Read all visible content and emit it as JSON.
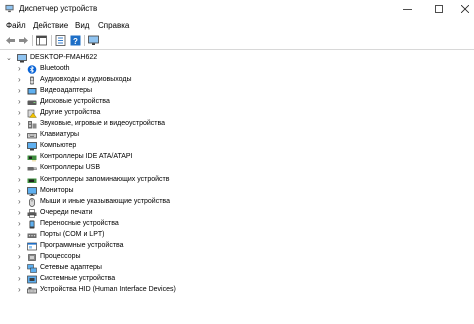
{
  "window": {
    "title": "Диспетчер устройств"
  },
  "menu": [
    "Файл",
    "Действие",
    "Вид",
    "Справка"
  ],
  "tree": {
    "root": "DESKTOP-FMAH622",
    "items": [
      {
        "label": "Bluetooth",
        "icon": "bluetooth-icon"
      },
      {
        "label": "Аудиовходы и аудиовыходы",
        "icon": "audio-io-icon"
      },
      {
        "label": "Видеоадаптеры",
        "icon": "display-adapter-icon"
      },
      {
        "label": "Дисковые устройства",
        "icon": "disk-drive-icon"
      },
      {
        "label": "Другие устройства",
        "icon": "other-device-icon"
      },
      {
        "label": "Звуковые, игровые и видеоустройства",
        "icon": "sound-video-icon"
      },
      {
        "label": "Клавиатуры",
        "icon": "keyboard-icon"
      },
      {
        "label": "Компьютер",
        "icon": "computer-icon"
      },
      {
        "label": "Контроллеры IDE ATA/ATAPI",
        "icon": "ide-controller-icon"
      },
      {
        "label": "Контроллеры USB",
        "icon": "usb-controller-icon"
      },
      {
        "label": "Контроллеры запоминающих устройств",
        "icon": "storage-controller-icon"
      },
      {
        "label": "Мониторы",
        "icon": "monitor-icon"
      },
      {
        "label": "Мыши и иные указывающие устройства",
        "icon": "mouse-icon"
      },
      {
        "label": "Очереди печати",
        "icon": "print-queue-icon"
      },
      {
        "label": "Переносные устройства",
        "icon": "portable-device-icon"
      },
      {
        "label": "Порты (COM и LPT)",
        "icon": "port-icon"
      },
      {
        "label": "Программные устройства",
        "icon": "software-device-icon"
      },
      {
        "label": "Процессоры",
        "icon": "processor-icon"
      },
      {
        "label": "Сетевые адаптеры",
        "icon": "network-adapter-icon"
      },
      {
        "label": "Системные устройства",
        "icon": "system-device-icon"
      },
      {
        "label": "Устройства HID (Human Interface Devices)",
        "icon": "hid-icon"
      }
    ]
  },
  "colors": {
    "accent": "#1e6fc7",
    "icon_dark": "#3c3c3c",
    "bluetooth": "#0a64d6"
  }
}
